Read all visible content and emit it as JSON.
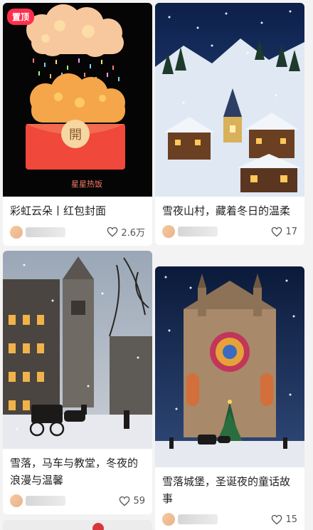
{
  "feed": {
    "cards": [
      {
        "pinned_label": "置顶",
        "cover_open_char": "開",
        "cover_caption": "星星热饭",
        "title": "彩虹云朵丨红包封面",
        "likes": "2.6万"
      },
      {
        "title": "雪夜山村，藏着冬日的温柔",
        "likes": "17"
      },
      {
        "title": "雪落，马车与教堂，冬夜的浪漫与温馨",
        "likes": "59"
      },
      {
        "title": "雪落城堡，圣诞夜的童话故事",
        "likes": "15"
      }
    ]
  },
  "icons": {
    "like": "heart-outline-icon"
  },
  "colors": {
    "pin_badge": "#ff2e4d",
    "envelope": "#f0483a",
    "background": "#f3f3f3"
  }
}
